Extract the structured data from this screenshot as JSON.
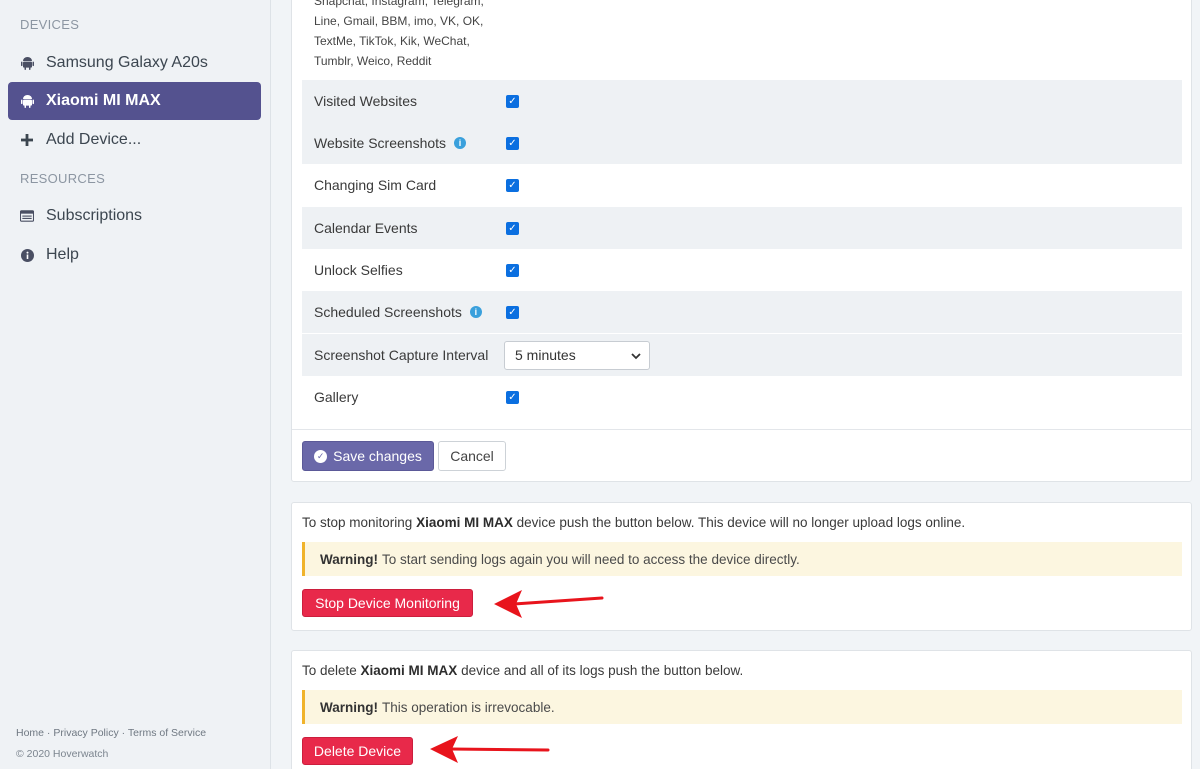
{
  "sidebar": {
    "devices_label": "DEVICES",
    "devices": [
      {
        "label": "Samsung Galaxy A20s",
        "icon": "android-icon",
        "active": false
      },
      {
        "label": "Xiaomi MI MAX",
        "icon": "android-icon",
        "active": true
      }
    ],
    "add_device_label": "Add Device...",
    "resources_label": "RESOURCES",
    "resources": [
      {
        "label": "Subscriptions",
        "icon": "list-icon"
      },
      {
        "label": "Help",
        "icon": "info-icon"
      }
    ],
    "footer": {
      "home": "Home",
      "privacy": "Privacy Policy",
      "terms": "Terms of Service",
      "separator": " · ",
      "copyright": "© 2020 Hoverwatch"
    }
  },
  "settings": {
    "apps_text": "Snapchat, Instagram, Telegram, Line, Gmail, BBM, imo, VK, OK, TextMe, TikTok, Kik, WeChat, Tumblr, Weico, Reddit",
    "rows": [
      {
        "label": "Visited Websites",
        "checked": true
      },
      {
        "label": "Website Screenshots",
        "checked": true,
        "info": true
      },
      {
        "label": "Changing Sim Card",
        "checked": true
      },
      {
        "label": "Calendar Events",
        "checked": true
      },
      {
        "label": "Unlock Selfies",
        "checked": true
      },
      {
        "label": "Scheduled Screenshots",
        "checked": true,
        "info": true
      },
      {
        "label": "Screenshot Capture Interval",
        "select_value": "5 minutes"
      },
      {
        "label": "Gallery",
        "checked": true
      }
    ],
    "save_label": "Save changes",
    "cancel_label": "Cancel"
  },
  "stop_monitoring": {
    "text_before": "To stop monitoring ",
    "device": "Xiaomi MI MAX",
    "text_after": " device push the button below. This device will no longer upload logs online.",
    "warning_title": "Warning!",
    "warning_text": "To start sending logs again you will need to access the device directly.",
    "button_label": "Stop Device Monitoring"
  },
  "delete_device": {
    "text_before": "To delete ",
    "device": "Xiaomi MI MAX",
    "text_after": " device and all of its logs push the button below.",
    "warning_title": "Warning!",
    "warning_text": "This operation is irrevocable.",
    "button_label": "Delete Device"
  },
  "colors": {
    "accent": "#54528f",
    "danger": "#e8294a",
    "checkbox": "#0b6fe0",
    "arrow": "#e8141c"
  }
}
